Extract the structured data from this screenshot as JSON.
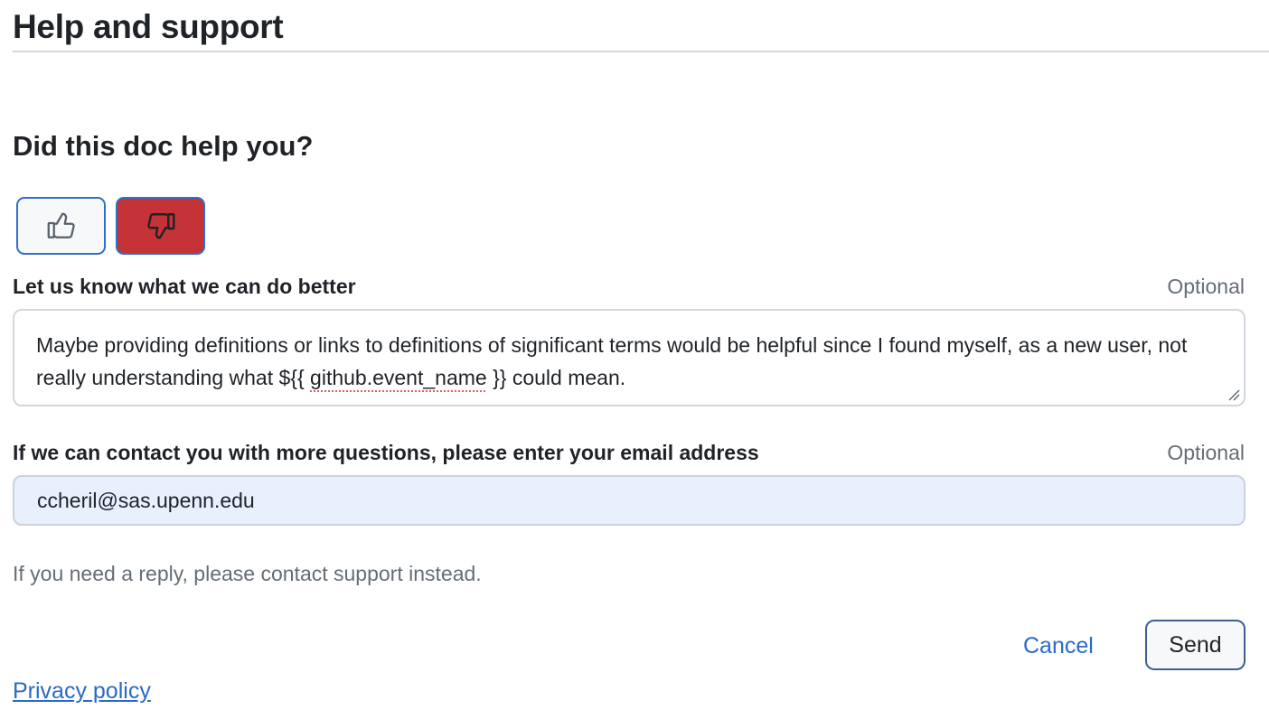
{
  "header": {
    "title": "Help and support"
  },
  "feedback": {
    "question": "Did this doc help you?",
    "thumbs_up_icon": "thumbs-up-icon",
    "thumbs_down_icon": "thumbs-down-icon",
    "selected_vote": "thumbs-down",
    "selected_color": "#c53337",
    "comment_label": "Let us know what we can do better",
    "comment_optional": "Optional",
    "comment_value_part1": "Maybe providing definitions or links to definitions of significant terms would be helpful since I found myself, as a new user, not really understanding what ${{ ",
    "comment_value_misspelled": "github.event_name",
    "comment_value_part2": " }} could mean.",
    "email_label": "If we can contact you with more questions, please enter your email address",
    "email_optional": "Optional",
    "email_value": "ccheril@sas.upenn.edu",
    "reply_note": "If you need a reply, please contact support instead.",
    "cancel_label": "Cancel",
    "send_label": "Send",
    "privacy_label": "Privacy policy"
  }
}
